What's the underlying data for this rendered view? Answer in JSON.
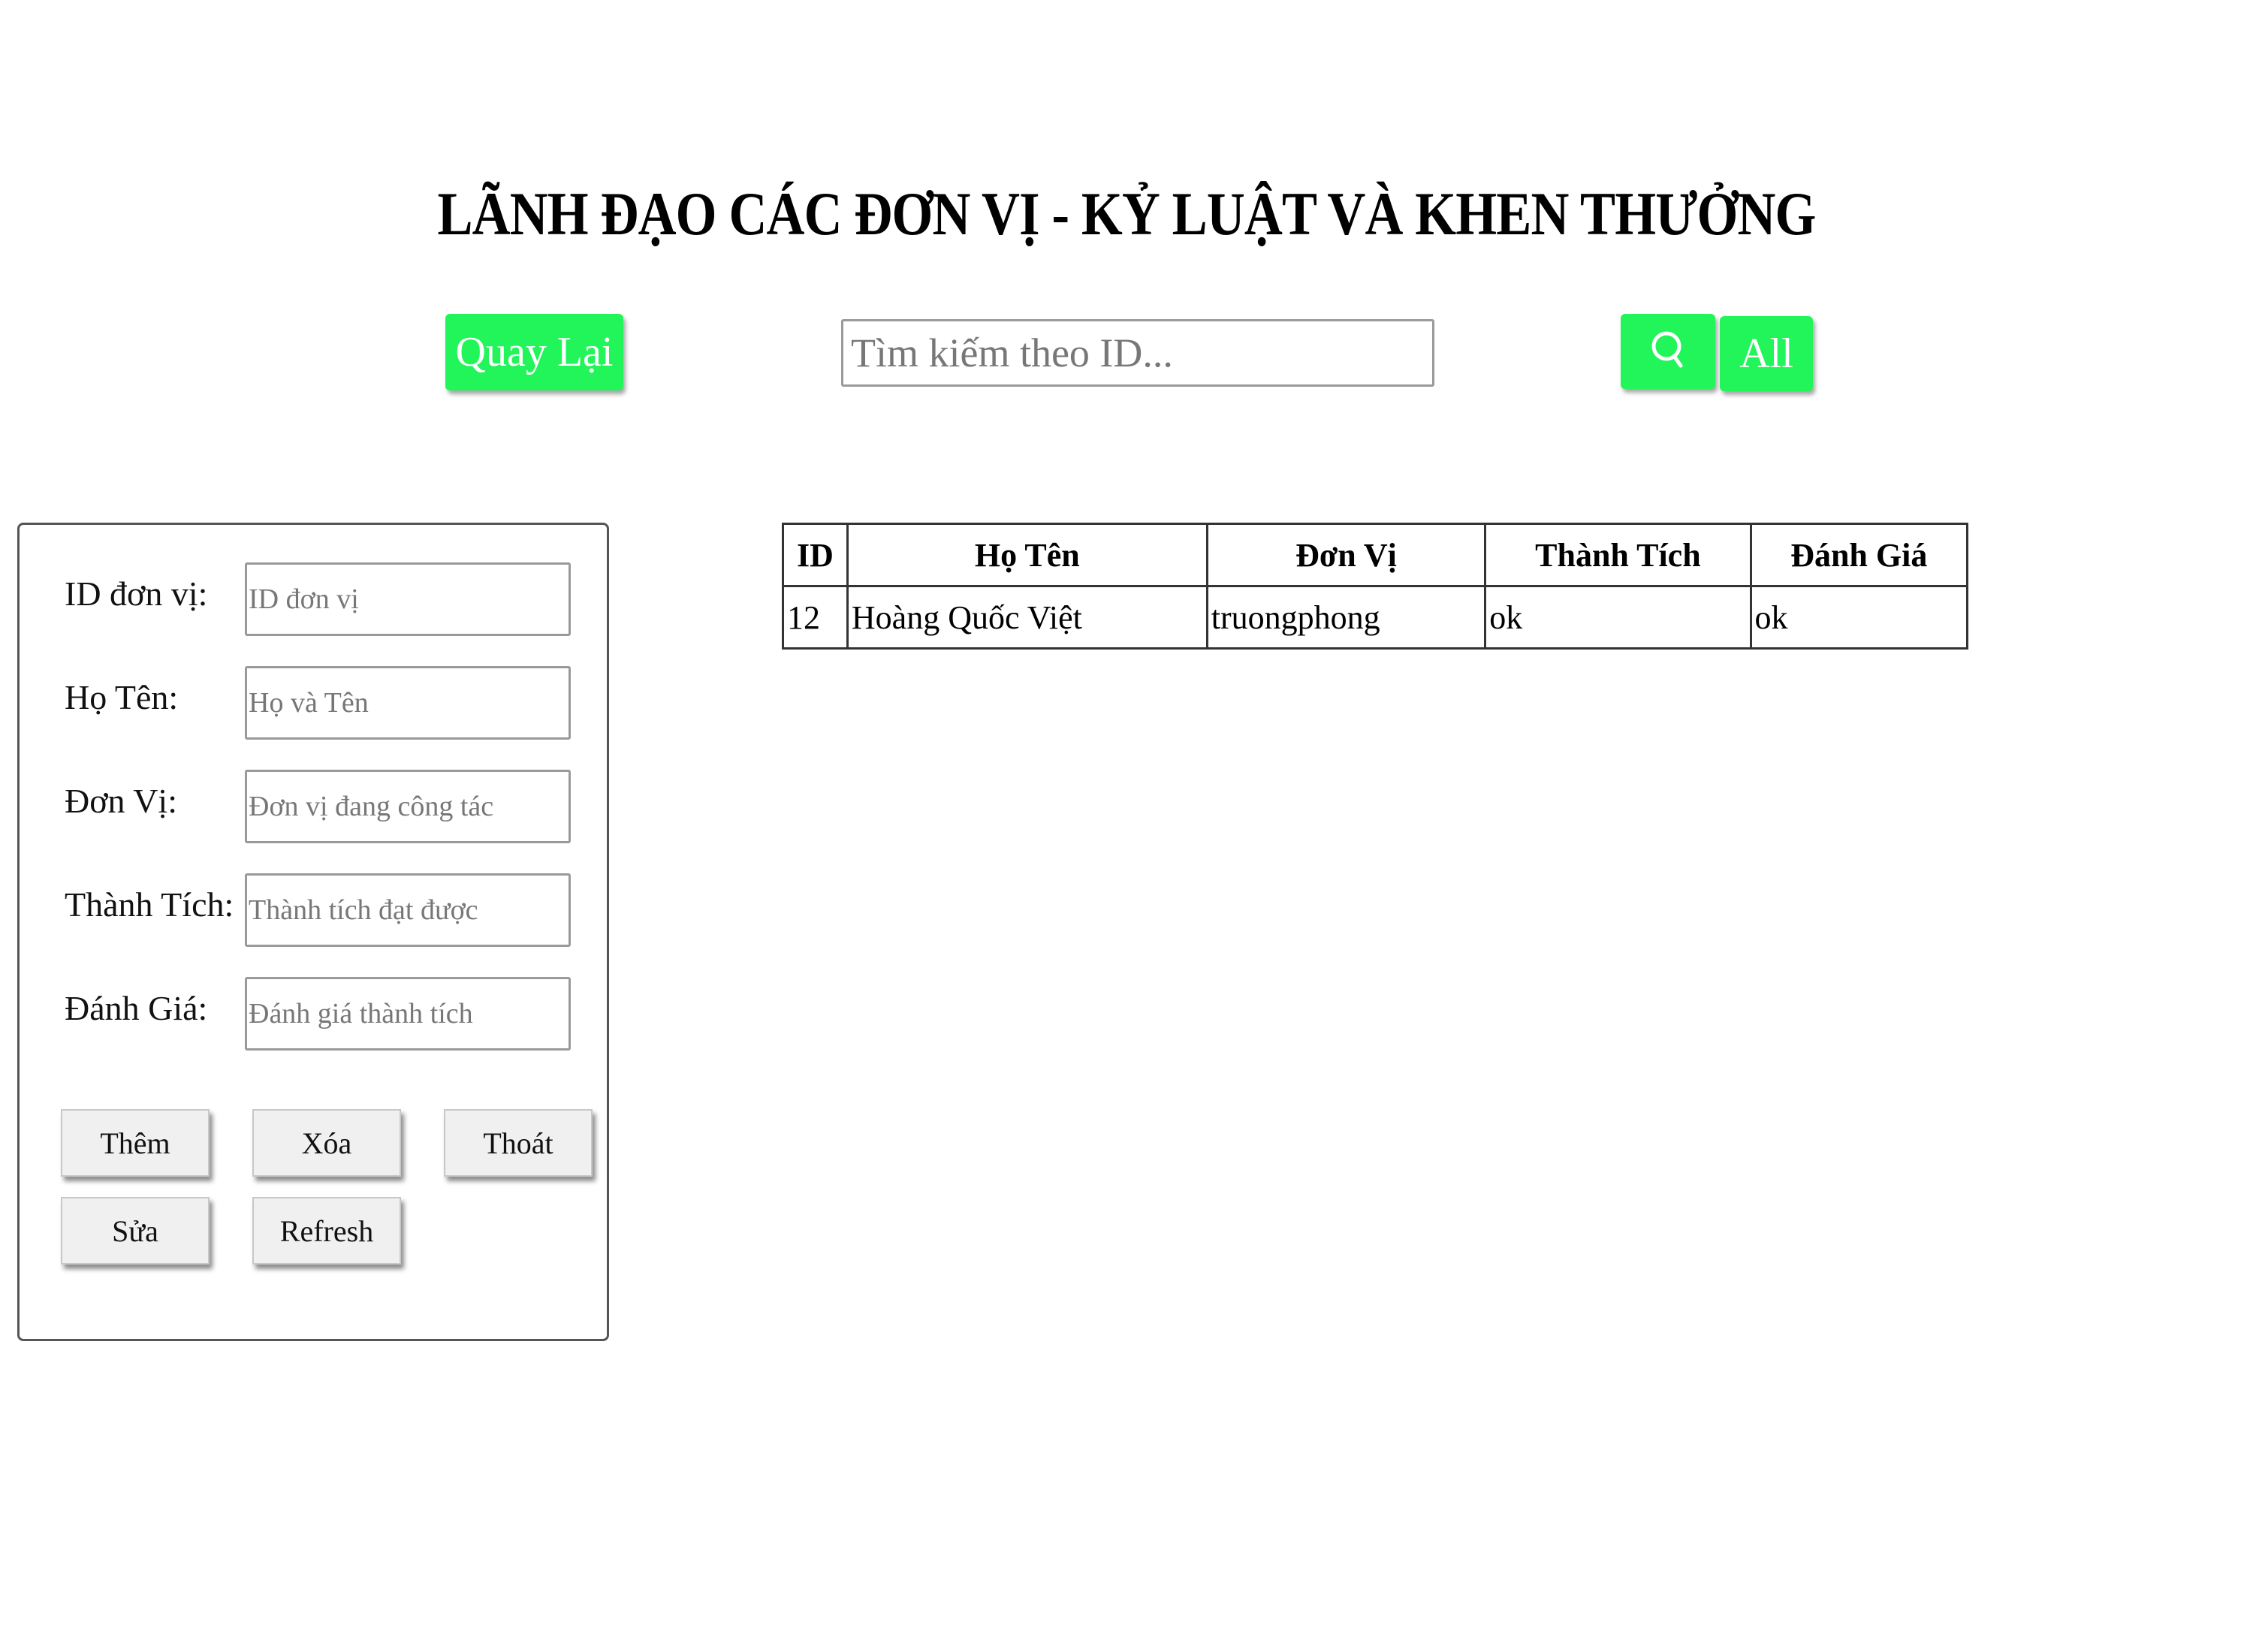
{
  "header": {
    "title": "LÃNH ĐẠO CÁC ĐƠN VỊ - KỶ LUẬT VÀ KHEN THƯỞNG"
  },
  "toolbar": {
    "back_label": "Quay Lại",
    "search_placeholder": "Tìm kiếm theo ID...",
    "search_icon": "search-icon",
    "all_label": "All",
    "accent_color": "#22f55a"
  },
  "form": {
    "fields": [
      {
        "label": "ID đơn vị:",
        "placeholder": "ID đơn vị"
      },
      {
        "label": "Họ Tên:",
        "placeholder": "Họ và Tên"
      },
      {
        "label": "Đơn Vị:",
        "placeholder": "Đơn vị đang công tác"
      },
      {
        "label": "Thành Tích:",
        "placeholder": "Thành tích đạt được"
      },
      {
        "label": "Đánh Giá:",
        "placeholder": "Đánh giá thành tích"
      }
    ],
    "buttons": {
      "add": "Thêm",
      "delete": "Xóa",
      "exit": "Thoát",
      "edit": "Sửa",
      "refresh": "Refresh"
    }
  },
  "table": {
    "headers": [
      "ID",
      "Họ Tên",
      "Đơn Vị",
      "Thành Tích",
      "Đánh Giá"
    ],
    "rows": [
      [
        "12",
        "Hoàng Quốc Việt",
        "truongphong",
        "ok",
        "ok"
      ]
    ]
  }
}
